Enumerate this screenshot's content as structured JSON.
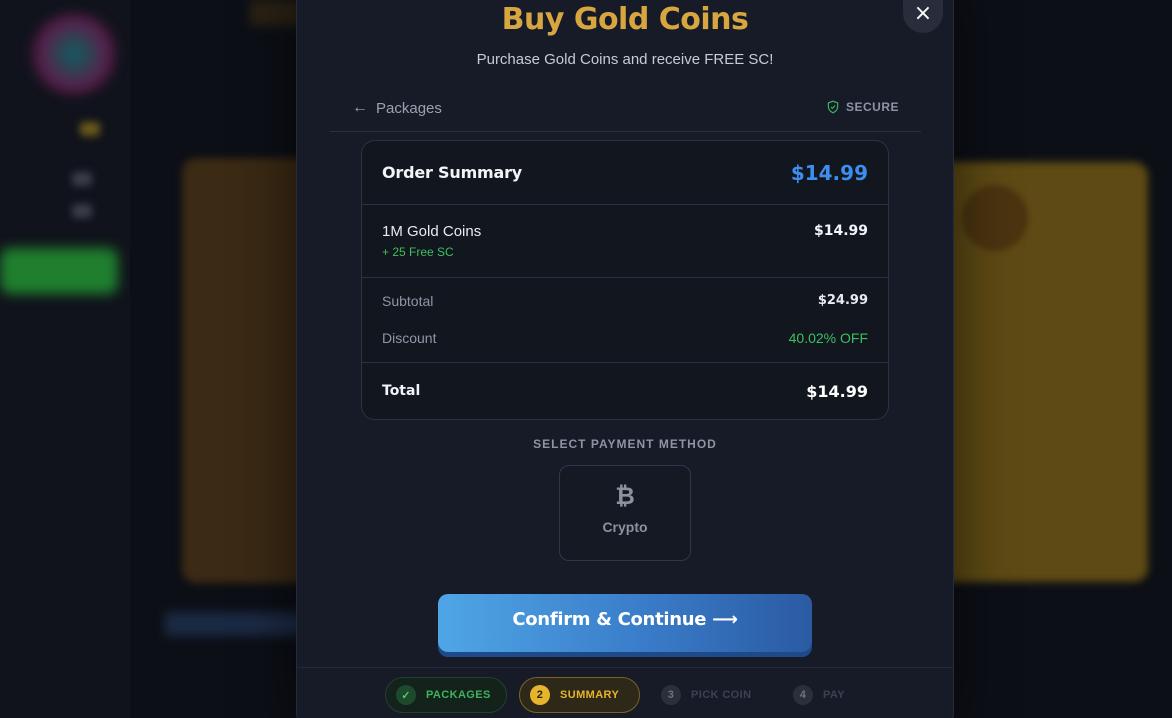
{
  "modal": {
    "title": "Buy Gold Coins",
    "subtitle": "Purchase Gold Coins and receive FREE SC!",
    "close_icon": "close-icon",
    "close_symbol": "×"
  },
  "nav": {
    "back_label": "Packages",
    "back_icon": "arrow-left-icon",
    "back_symbol": "←",
    "secure_label": "SECURE",
    "secure_icon": "shield-check-icon"
  },
  "order_summary": {
    "heading": "Order Summary",
    "heading_amount": "$14.99",
    "item": {
      "name": "1M Gold Coins",
      "bonus": "+ 25 Free SC",
      "price": "$14.99"
    },
    "subtotal_label": "Subtotal",
    "subtotal_value": "$24.99",
    "discount_label": "Discount",
    "discount_value": "40.02% OFF",
    "total_label": "Total",
    "total_value": "$14.99"
  },
  "payment": {
    "section_label": "SELECT PAYMENT METHOD",
    "methods": [
      {
        "label": "Crypto",
        "icon": "bitcoin-icon",
        "symbol": "₿"
      }
    ]
  },
  "confirm_button": {
    "label": "Confirm & Continue ⟶"
  },
  "steps": [
    {
      "number": "✓",
      "label": "PACKAGES",
      "state": "done"
    },
    {
      "number": "2",
      "label": "SUMMARY",
      "state": "active"
    },
    {
      "number": "3",
      "label": "PICK COIN",
      "state": "todo"
    },
    {
      "number": "4",
      "label": "PAY",
      "state": "todo"
    }
  ],
  "colors": {
    "title_gold": "#d8a640",
    "accent_blue": "#3e8ef0",
    "success_green": "#3fbf5d",
    "active_step": "#e8b42e"
  }
}
